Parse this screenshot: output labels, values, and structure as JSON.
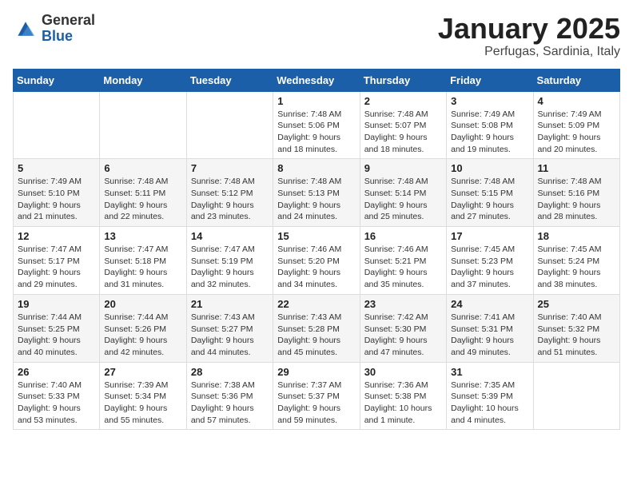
{
  "logo": {
    "general": "General",
    "blue": "Blue"
  },
  "header": {
    "month": "January 2025",
    "location": "Perfugas, Sardinia, Italy"
  },
  "weekdays": [
    "Sunday",
    "Monday",
    "Tuesday",
    "Wednesday",
    "Thursday",
    "Friday",
    "Saturday"
  ],
  "weeks": [
    [
      {
        "day": "",
        "info": ""
      },
      {
        "day": "",
        "info": ""
      },
      {
        "day": "",
        "info": ""
      },
      {
        "day": "1",
        "info": "Sunrise: 7:48 AM\nSunset: 5:06 PM\nDaylight: 9 hours and 18 minutes."
      },
      {
        "day": "2",
        "info": "Sunrise: 7:48 AM\nSunset: 5:07 PM\nDaylight: 9 hours and 18 minutes."
      },
      {
        "day": "3",
        "info": "Sunrise: 7:49 AM\nSunset: 5:08 PM\nDaylight: 9 hours and 19 minutes."
      },
      {
        "day": "4",
        "info": "Sunrise: 7:49 AM\nSunset: 5:09 PM\nDaylight: 9 hours and 20 minutes."
      }
    ],
    [
      {
        "day": "5",
        "info": "Sunrise: 7:49 AM\nSunset: 5:10 PM\nDaylight: 9 hours and 21 minutes."
      },
      {
        "day": "6",
        "info": "Sunrise: 7:48 AM\nSunset: 5:11 PM\nDaylight: 9 hours and 22 minutes."
      },
      {
        "day": "7",
        "info": "Sunrise: 7:48 AM\nSunset: 5:12 PM\nDaylight: 9 hours and 23 minutes."
      },
      {
        "day": "8",
        "info": "Sunrise: 7:48 AM\nSunset: 5:13 PM\nDaylight: 9 hours and 24 minutes."
      },
      {
        "day": "9",
        "info": "Sunrise: 7:48 AM\nSunset: 5:14 PM\nDaylight: 9 hours and 25 minutes."
      },
      {
        "day": "10",
        "info": "Sunrise: 7:48 AM\nSunset: 5:15 PM\nDaylight: 9 hours and 27 minutes."
      },
      {
        "day": "11",
        "info": "Sunrise: 7:48 AM\nSunset: 5:16 PM\nDaylight: 9 hours and 28 minutes."
      }
    ],
    [
      {
        "day": "12",
        "info": "Sunrise: 7:47 AM\nSunset: 5:17 PM\nDaylight: 9 hours and 29 minutes."
      },
      {
        "day": "13",
        "info": "Sunrise: 7:47 AM\nSunset: 5:18 PM\nDaylight: 9 hours and 31 minutes."
      },
      {
        "day": "14",
        "info": "Sunrise: 7:47 AM\nSunset: 5:19 PM\nDaylight: 9 hours and 32 minutes."
      },
      {
        "day": "15",
        "info": "Sunrise: 7:46 AM\nSunset: 5:20 PM\nDaylight: 9 hours and 34 minutes."
      },
      {
        "day": "16",
        "info": "Sunrise: 7:46 AM\nSunset: 5:21 PM\nDaylight: 9 hours and 35 minutes."
      },
      {
        "day": "17",
        "info": "Sunrise: 7:45 AM\nSunset: 5:23 PM\nDaylight: 9 hours and 37 minutes."
      },
      {
        "day": "18",
        "info": "Sunrise: 7:45 AM\nSunset: 5:24 PM\nDaylight: 9 hours and 38 minutes."
      }
    ],
    [
      {
        "day": "19",
        "info": "Sunrise: 7:44 AM\nSunset: 5:25 PM\nDaylight: 9 hours and 40 minutes."
      },
      {
        "day": "20",
        "info": "Sunrise: 7:44 AM\nSunset: 5:26 PM\nDaylight: 9 hours and 42 minutes."
      },
      {
        "day": "21",
        "info": "Sunrise: 7:43 AM\nSunset: 5:27 PM\nDaylight: 9 hours and 44 minutes."
      },
      {
        "day": "22",
        "info": "Sunrise: 7:43 AM\nSunset: 5:28 PM\nDaylight: 9 hours and 45 minutes."
      },
      {
        "day": "23",
        "info": "Sunrise: 7:42 AM\nSunset: 5:30 PM\nDaylight: 9 hours and 47 minutes."
      },
      {
        "day": "24",
        "info": "Sunrise: 7:41 AM\nSunset: 5:31 PM\nDaylight: 9 hours and 49 minutes."
      },
      {
        "day": "25",
        "info": "Sunrise: 7:40 AM\nSunset: 5:32 PM\nDaylight: 9 hours and 51 minutes."
      }
    ],
    [
      {
        "day": "26",
        "info": "Sunrise: 7:40 AM\nSunset: 5:33 PM\nDaylight: 9 hours and 53 minutes."
      },
      {
        "day": "27",
        "info": "Sunrise: 7:39 AM\nSunset: 5:34 PM\nDaylight: 9 hours and 55 minutes."
      },
      {
        "day": "28",
        "info": "Sunrise: 7:38 AM\nSunset: 5:36 PM\nDaylight: 9 hours and 57 minutes."
      },
      {
        "day": "29",
        "info": "Sunrise: 7:37 AM\nSunset: 5:37 PM\nDaylight: 9 hours and 59 minutes."
      },
      {
        "day": "30",
        "info": "Sunrise: 7:36 AM\nSunset: 5:38 PM\nDaylight: 10 hours and 1 minute."
      },
      {
        "day": "31",
        "info": "Sunrise: 7:35 AM\nSunset: 5:39 PM\nDaylight: 10 hours and 4 minutes."
      },
      {
        "day": "",
        "info": ""
      }
    ]
  ]
}
